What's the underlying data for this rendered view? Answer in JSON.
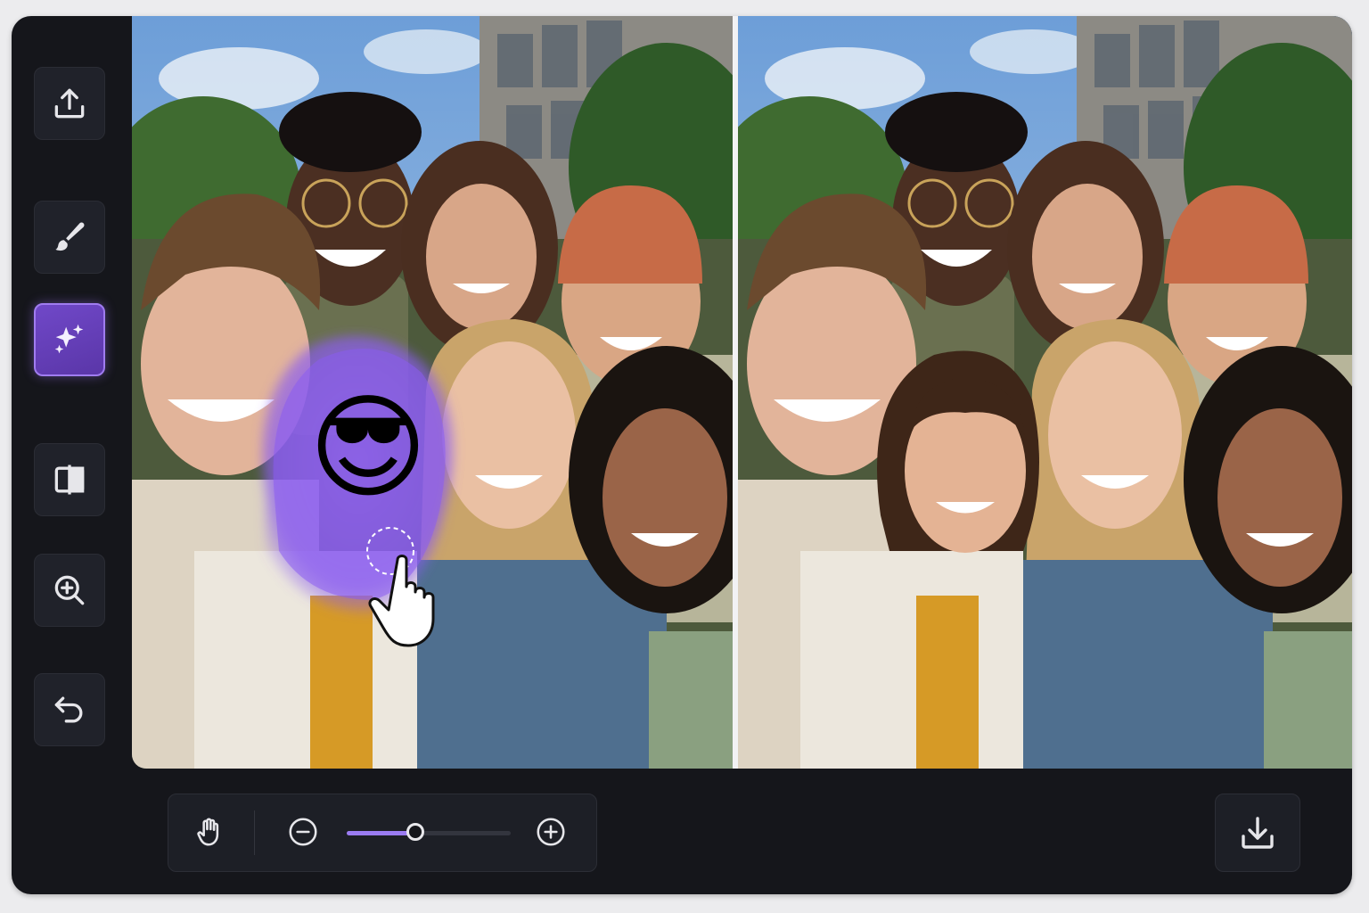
{
  "sidebar": {
    "tools": [
      {
        "id": "upload",
        "icon": "upload-icon"
      },
      {
        "id": "brush",
        "icon": "paintbrush-icon"
      },
      {
        "id": "ai-enhance",
        "icon": "sparkles-icon",
        "active": true
      },
      {
        "id": "compare",
        "icon": "split-compare-icon"
      },
      {
        "id": "zoom",
        "icon": "zoom-in-icon"
      },
      {
        "id": "undo",
        "icon": "undo-icon"
      }
    ]
  },
  "editor": {
    "left_pane": {
      "state": "edited",
      "overlay_emoji": "😎",
      "mask_color": "#8a5cf0"
    },
    "right_pane": {
      "state": "result"
    }
  },
  "bottom_bar": {
    "pan_icon": "hand-icon",
    "zoom_out_icon": "minus-circle-icon",
    "zoom_in_icon": "plus-circle-icon",
    "zoom_level": 0.42,
    "download_icon": "download-icon"
  },
  "colors": {
    "background": "#15161b",
    "accent": "#8a5cf0",
    "panel": "#1d1f26"
  }
}
